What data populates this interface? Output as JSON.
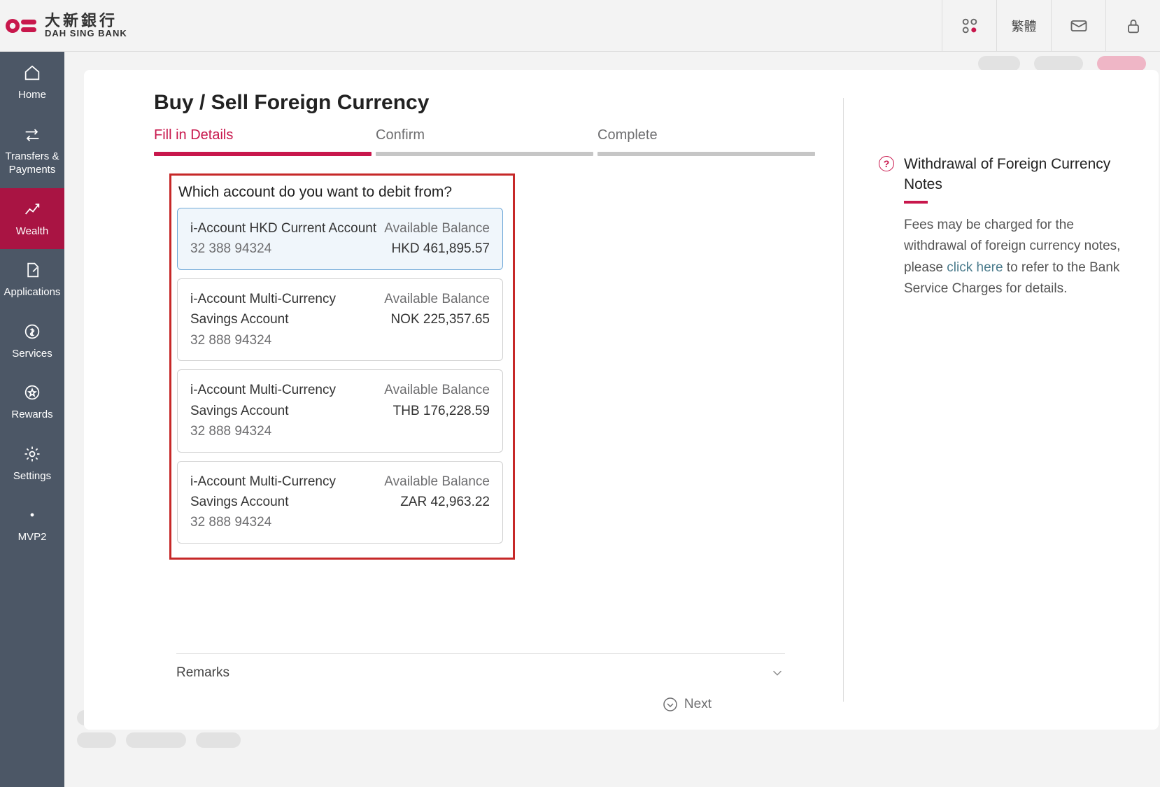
{
  "topbar": {
    "logo_cn": "大新銀行",
    "logo_en": "DAH SING BANK",
    "lang_label": "繁體"
  },
  "sidebar": {
    "items": [
      {
        "label": "Home"
      },
      {
        "label": "Transfers & Payments"
      },
      {
        "label": "Wealth"
      },
      {
        "label": "Applications"
      },
      {
        "label": "Services"
      },
      {
        "label": "Rewards"
      },
      {
        "label": "Settings"
      },
      {
        "label": "MVP2"
      }
    ]
  },
  "page": {
    "title": "Buy / Sell Foreign Currency",
    "steps": [
      "Fill in Details",
      "Confirm",
      "Complete"
    ],
    "select_label": "Which account do you want to debit from?",
    "balance_label": "Available Balance",
    "accounts": [
      {
        "name": "i-Account HKD Current Account",
        "number": "32 388 94324",
        "currency": "HKD",
        "amount": "461,895.57",
        "selected": true
      },
      {
        "name": "i-Account Multi-Currency Savings Account",
        "number": "32 888 94324",
        "currency": "NOK",
        "amount": "225,357.65",
        "selected": false
      },
      {
        "name": "i-Account Multi-Currency Savings Account",
        "number": "32 888 94324",
        "currency": "THB",
        "amount": "176,228.59",
        "selected": false
      },
      {
        "name": "i-Account Multi-Currency Savings Account",
        "number": "32 888 94324",
        "currency": "ZAR",
        "amount": "42,963.22",
        "selected": false
      }
    ],
    "remarks": "Remarks",
    "next": "Next"
  },
  "info": {
    "title": "Withdrawal of Foreign Currency Notes",
    "body_pre": "Fees may be charged for the withdrawal of foreign currency notes, please ",
    "link": "click here",
    "body_post": " to refer to the Bank Service Charges for details."
  }
}
